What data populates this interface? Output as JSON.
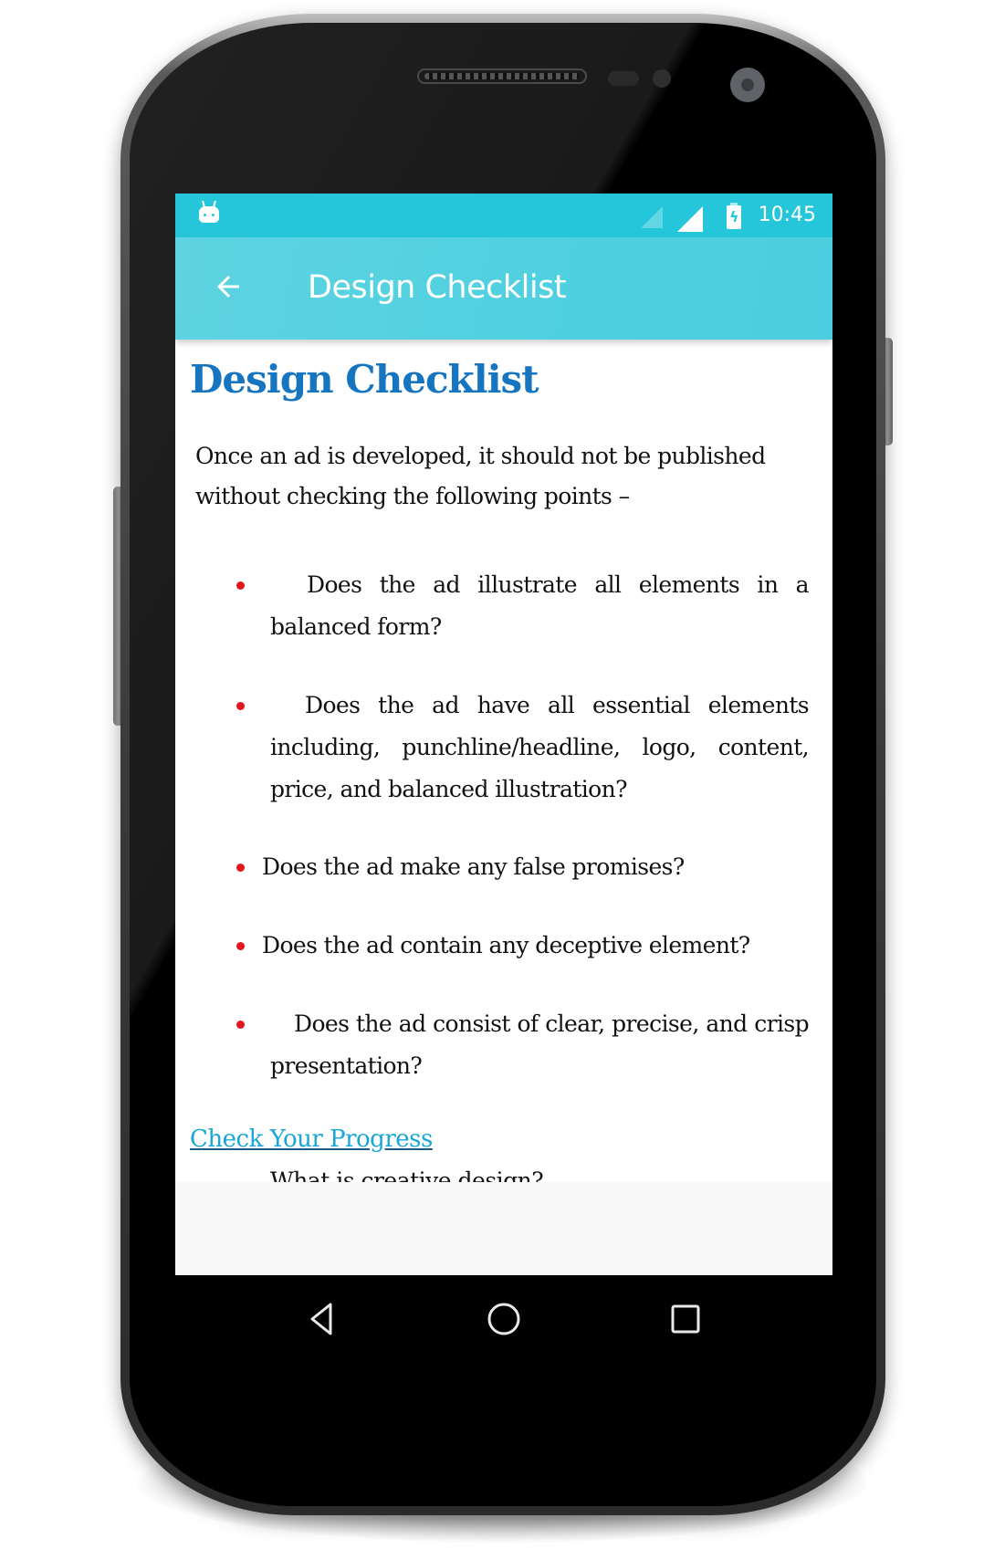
{
  "status_bar": {
    "time": "10:45",
    "icons": [
      "android-notification-icon",
      "signal-empty-icon",
      "signal-full-icon",
      "battery-charging-icon"
    ]
  },
  "toolbar": {
    "back_icon": "arrow-left-icon",
    "title": "Design Checklist"
  },
  "article": {
    "heading": "Design Checklist",
    "intro": "Once an ad is developed, it should not be published without checking the following points –",
    "checklist": [
      {
        "text": "Does the ad illustrate all elements in a balanced form?"
      },
      {
        "text": "Does the ad have all essential elements including, punchline/headline, logo, content, price, and balanced illustration?"
      },
      {
        "text": "Does the ad make any false promises?"
      },
      {
        "text": "Does the ad contain any deceptive element?"
      },
      {
        "text": "Does the ad consist of clear, precise, and crisp presentation?"
      }
    ],
    "progress_link": "Check Your Progress",
    "progress_items": [
      {
        "text": "What is creative design?"
      }
    ]
  },
  "nav_bar": {
    "buttons": [
      "back-triangle-icon",
      "home-circle-icon",
      "recents-square-icon"
    ]
  },
  "colors": {
    "status_bar": "#26C6DA",
    "toolbar": "#4DD0E1",
    "heading": "#1675C0",
    "link": "#19A7D8",
    "bullet": "#E4161B"
  }
}
